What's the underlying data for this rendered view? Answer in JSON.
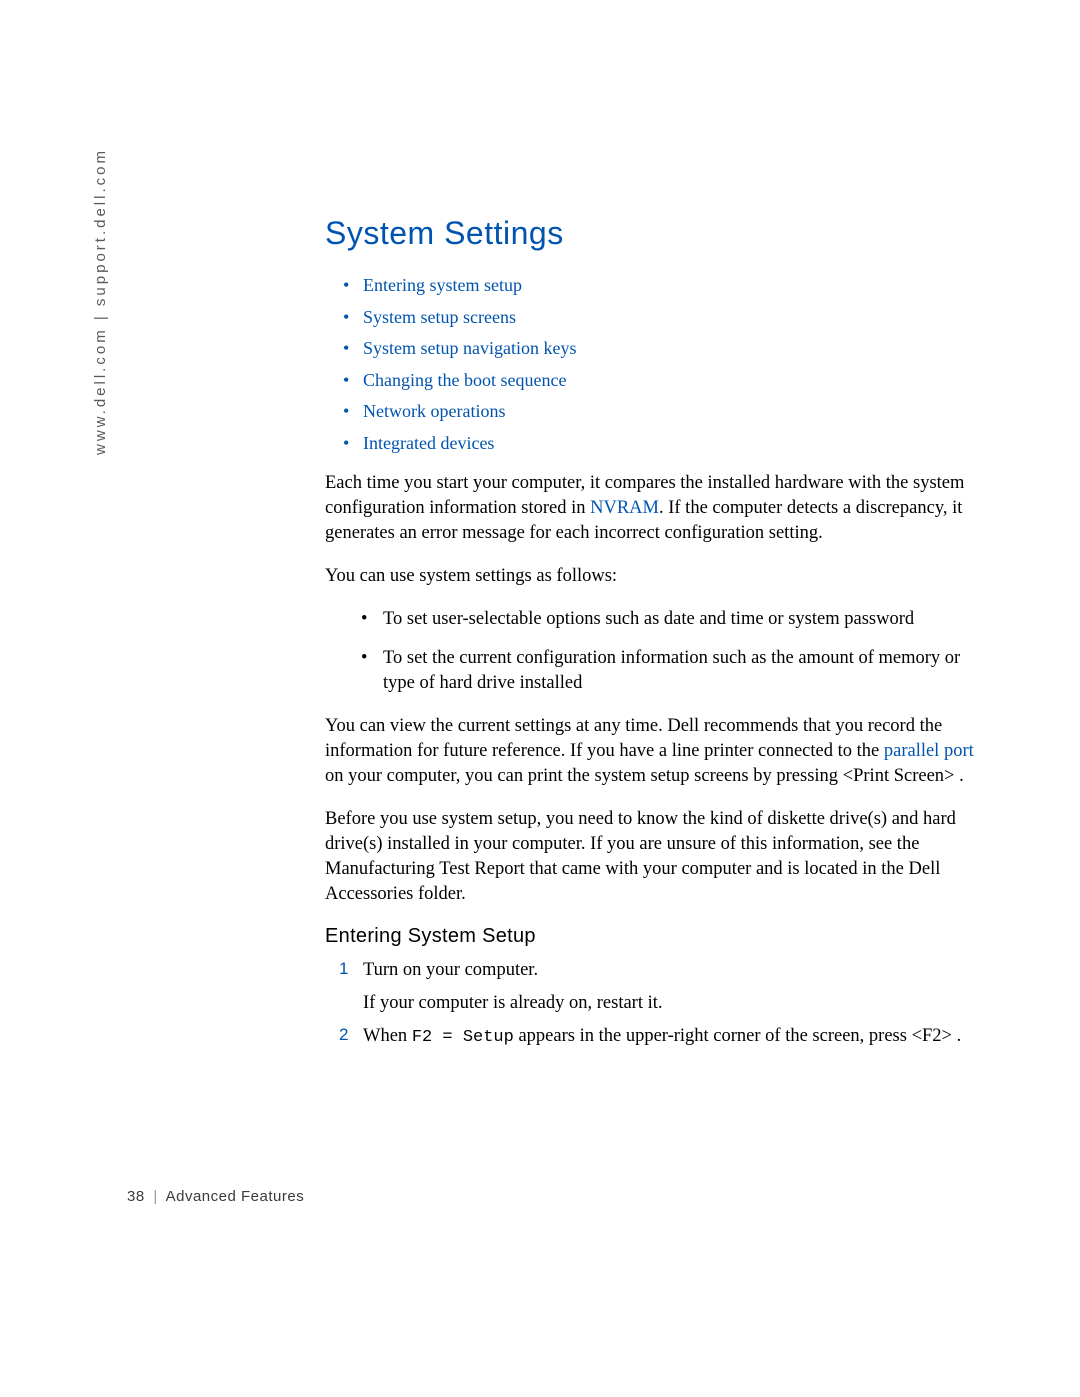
{
  "sidebar": {
    "url_text": "www.dell.com | support.dell.com"
  },
  "heading": "System Settings",
  "toc": [
    "Entering system setup",
    "System setup screens",
    "System setup navigation keys",
    "Changing the boot sequence",
    "Network operations",
    "Integrated devices"
  ],
  "paragraphs": {
    "p1a": "Each time you start your computer, it compares the installed hardware with the system configuration information stored in ",
    "p1_link": "NVRAM",
    "p1b": ". If the computer detects a discrepancy, it generates an error message for each incorrect configuration setting.",
    "p2": "You can use system settings as follows:",
    "p3a": "You can view the current settings at any time. Dell recommends that you record the information for future reference. If you have a line printer connected to the ",
    "p3_link": "parallel port",
    "p3b": " on your computer, you can print the system setup screens by pressing <Print Screen> .",
    "p4": "Before you use system setup, you need to know the kind of diskette drive(s) and hard drive(s) installed in your computer. If you are unsure of this information, see the Manufacturing Test Report that came with your computer and is located in the Dell Accessories folder."
  },
  "bullets": [
    "To set user-selectable options such as date and time or system password",
    "To set the current configuration information such as the amount of memory or type of hard drive installed"
  ],
  "sub_heading": "Entering System Setup",
  "steps": {
    "s1_num": "1",
    "s1_text": "Turn on your computer.",
    "s1_follow": "If your computer is already on, restart it.",
    "s2_num": "2",
    "s2a": "When ",
    "s2_mono": "F2 = Setup",
    "s2b": " appears in the upper-right corner of the screen, press <F2> ."
  },
  "footer": {
    "page_num": "38",
    "section": "Advanced Features"
  }
}
